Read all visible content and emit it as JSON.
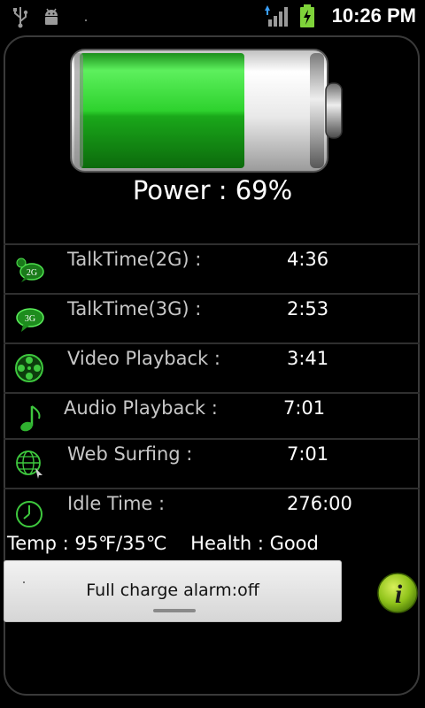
{
  "status_bar": {
    "time": "10:26 PM",
    "icons": [
      "usb-icon",
      "android-debug-icon",
      "signal-icon",
      "battery-charging-icon"
    ]
  },
  "battery": {
    "level_percent": 69,
    "power_label": "Power : 69%",
    "fill_color": "#2ecc2e"
  },
  "rows": [
    {
      "icon": "talk-2g-icon",
      "label": "TalkTime(2G) :",
      "value": "4:36"
    },
    {
      "icon": "talk-3g-icon",
      "label": "TalkTime(3G) :",
      "value": "2:53"
    },
    {
      "icon": "video-reel-icon",
      "label": "Video Playback :",
      "value": "3:41"
    },
    {
      "icon": "music-note-icon",
      "label": "Audio Playback :",
      "value": "7:01"
    },
    {
      "icon": "globe-icon",
      "label": "Web Surfing :",
      "value": "7:01"
    },
    {
      "icon": "clock-icon",
      "label": "Idle Time :",
      "value": "276:00"
    }
  ],
  "info_line": "Temp : 95℉/35℃    Health : Good",
  "alarm_button": {
    "label": "Full charge alarm:off"
  },
  "info_button": {
    "icon": "info-icon"
  },
  "colors": {
    "accent_green": "#2ecc2e",
    "background": "#000000"
  }
}
